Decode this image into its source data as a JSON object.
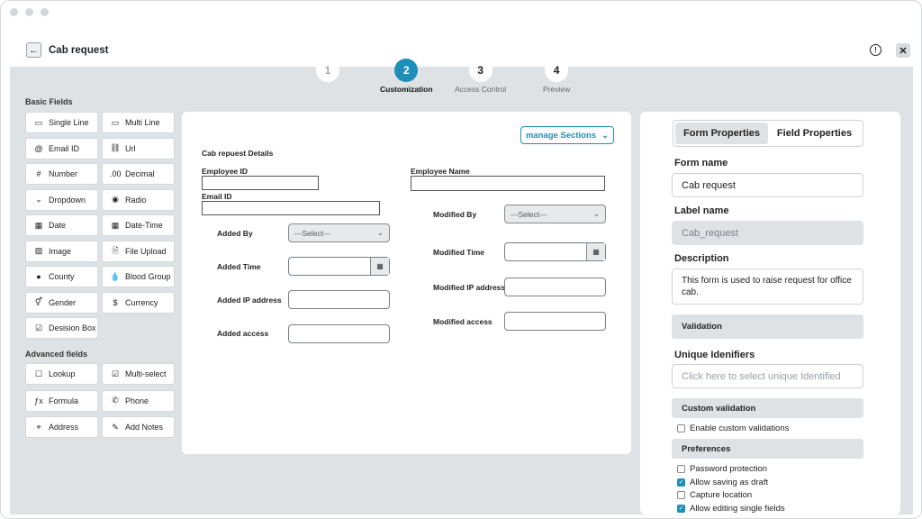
{
  "header": {
    "title": "Cab request",
    "back_icon": "arrow-left-icon",
    "close_label": "✕",
    "info_label": "!"
  },
  "steps": [
    {
      "num": "1",
      "label": "",
      "state": "dim"
    },
    {
      "num": "2",
      "label": "Customization",
      "state": "active"
    },
    {
      "num": "3",
      "label": "Access Control",
      "state": "normal"
    },
    {
      "num": "4",
      "label": "Preview",
      "state": "normal"
    }
  ],
  "palette": {
    "basic_title": "Basic Fields",
    "basic": [
      {
        "label": "Single Line",
        "icon": "▭"
      },
      {
        "label": "Multi Line",
        "icon": "▭"
      },
      {
        "label": "Email ID",
        "icon": "@"
      },
      {
        "label": "Url",
        "icon": "⛓"
      },
      {
        "label": "Number",
        "icon": "#"
      },
      {
        "label": "Decimal",
        "icon": ".00"
      },
      {
        "label": "Dropdown",
        "icon": "⌄"
      },
      {
        "label": "Radio",
        "icon": "◉"
      },
      {
        "label": "Date",
        "icon": "▦"
      },
      {
        "label": "Date-Time",
        "icon": "▦"
      },
      {
        "label": "Image",
        "icon": "▨"
      },
      {
        "label": "File Upload",
        "icon": "🗎"
      },
      {
        "label": "County",
        "icon": "●"
      },
      {
        "label": "Blood Group",
        "icon": "💧"
      },
      {
        "label": "Gender",
        "icon": "⚥"
      },
      {
        "label": "Currency",
        "icon": "$"
      },
      {
        "label": "Desision Box",
        "icon": "☑"
      }
    ],
    "advanced_title": "Advanced fields",
    "advanced": [
      {
        "label": "Lookup",
        "icon": "☐"
      },
      {
        "label": "Multi-select",
        "icon": "☑"
      },
      {
        "label": "Formula",
        "icon": "ƒx"
      },
      {
        "label": "Phone",
        "icon": "✆"
      },
      {
        "label": "Address",
        "icon": "⌖"
      },
      {
        "label": "Add Notes",
        "icon": "✎"
      }
    ]
  },
  "form": {
    "manage_label": "manage Sections",
    "section_title": "Cab repuest Details",
    "employee_id": "Employee ID",
    "employee_name": "Employee Name",
    "email_id": "Email ID",
    "added_by": "Added By",
    "added_time": "Added Time",
    "added_ip": "Added IP address",
    "added_access": "Added access",
    "modified_by": "Modified By",
    "modified_time": "Modified Time",
    "modified_ip": "Modified IP address",
    "modified_access": "Modified access",
    "select_placeholder": "---Select---"
  },
  "props": {
    "tab_form": "Form Properties",
    "tab_field": "Field Properties",
    "form_name_label": "Form name",
    "form_name_value": "Cab request",
    "label_name_label": "Label name",
    "label_name_value": "Cab_request",
    "description_label": "Description",
    "description_value": "This form is used to raise request for office cab.",
    "validation": "Validation",
    "unique_label": "Unique Idenifiers",
    "unique_placeholder": "Click here to select unique Identified",
    "custom_validation": "Custom validation",
    "enable_custom": "Enable custom validations",
    "preferences": "Preferences",
    "pref_items": [
      {
        "label": "Password protection",
        "checked": false
      },
      {
        "label": "Allow saving as draft",
        "checked": true
      },
      {
        "label": "Capture location",
        "checked": false
      },
      {
        "label": "Allow editing single fields",
        "checked": true
      }
    ]
  },
  "colors": {
    "accent": "#1e8fb8",
    "canvas": "#dfe2e4"
  }
}
